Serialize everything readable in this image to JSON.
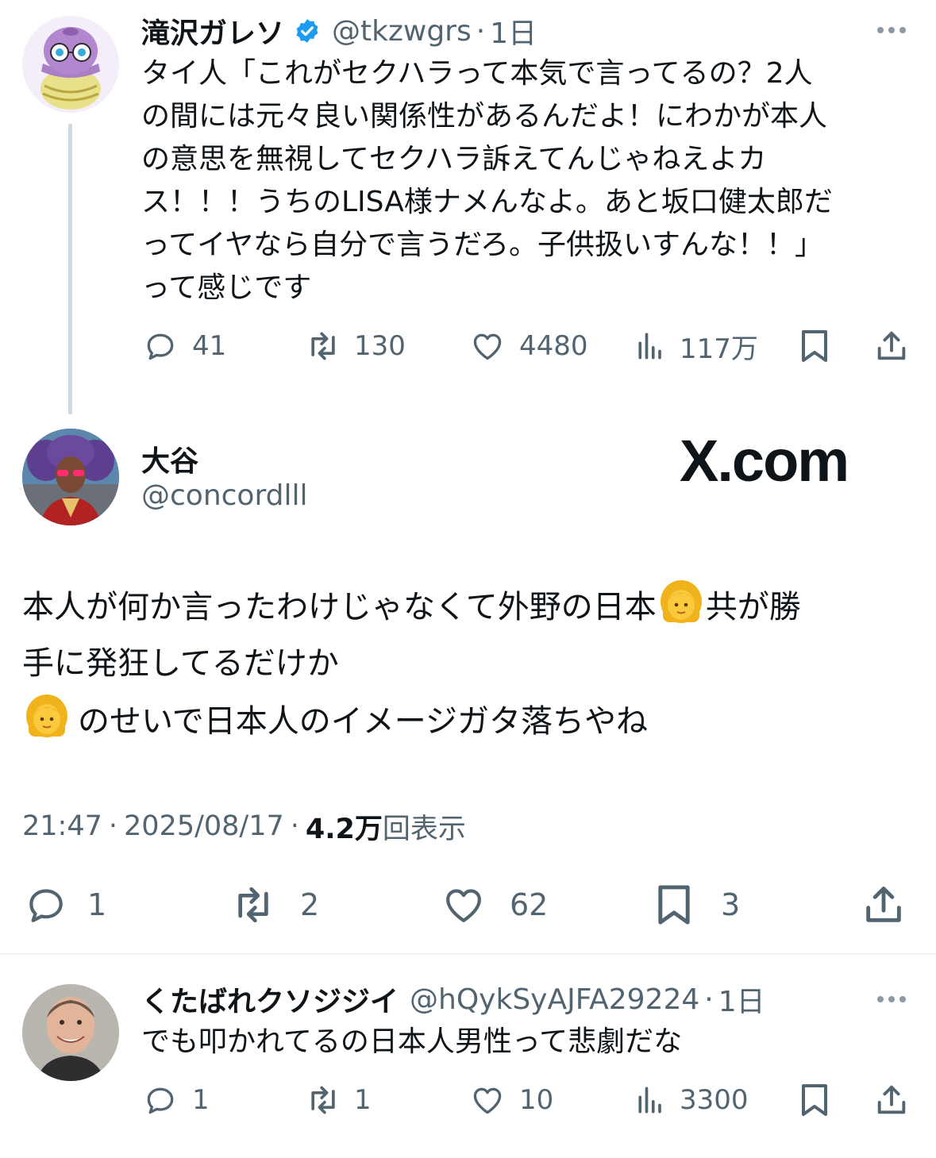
{
  "reply_parent": {
    "name": "滝沢ガレソ",
    "handle": "@tkzwgrs",
    "sep": "·",
    "age": "1日",
    "lines": [
      "タイ人「これがセクハラって本気で言ってるの？2人",
      "の間には元々良い関係性があるんだよ！にわかが本人",
      "の意思を無視してセクハラ訴えてんじゃねえよカ",
      "ス！！！うちのLISA様ナメんなよ。あと坂口健太郎だ",
      "ってイヤなら自分で言うだろ。子供扱いすんな！！」",
      "って感じです"
    ],
    "actions": {
      "replies": "41",
      "reposts": "130",
      "likes": "4480",
      "views": "117万"
    }
  },
  "main_post": {
    "name": "大谷",
    "handle": "@concordlll",
    "watermark": "X.com",
    "line1_a": "本人が何か言ったわけじゃなくて外野の日本",
    "line1_b": "共が勝",
    "line2": "手に発狂してるだけか",
    "line3": "のせいで日本人のイメージガタ落ちやね",
    "time": "21:47",
    "sep1": "·",
    "date": "2025/08/17",
    "sep2": "·",
    "views_count": "4.2万",
    "views_label": "回表示",
    "actions": {
      "replies": "1",
      "reposts": "2",
      "likes": "62",
      "bookmarks": "3"
    }
  },
  "reply": {
    "name": "くたばれクソジジイ",
    "handle": "@hQykSyAJFA29224",
    "sep": "·",
    "age": "1日",
    "text": "でも叩かれてるの日本人男性って悲劇だな",
    "actions": {
      "replies": "1",
      "reposts": "1",
      "likes": "10",
      "views": "3300"
    }
  },
  "colors": {
    "text": "#0f1419",
    "secondary": "#536471",
    "divider": "#eff3f4",
    "verified": "#1d9bf0",
    "thread_line": "#cfd9de"
  }
}
